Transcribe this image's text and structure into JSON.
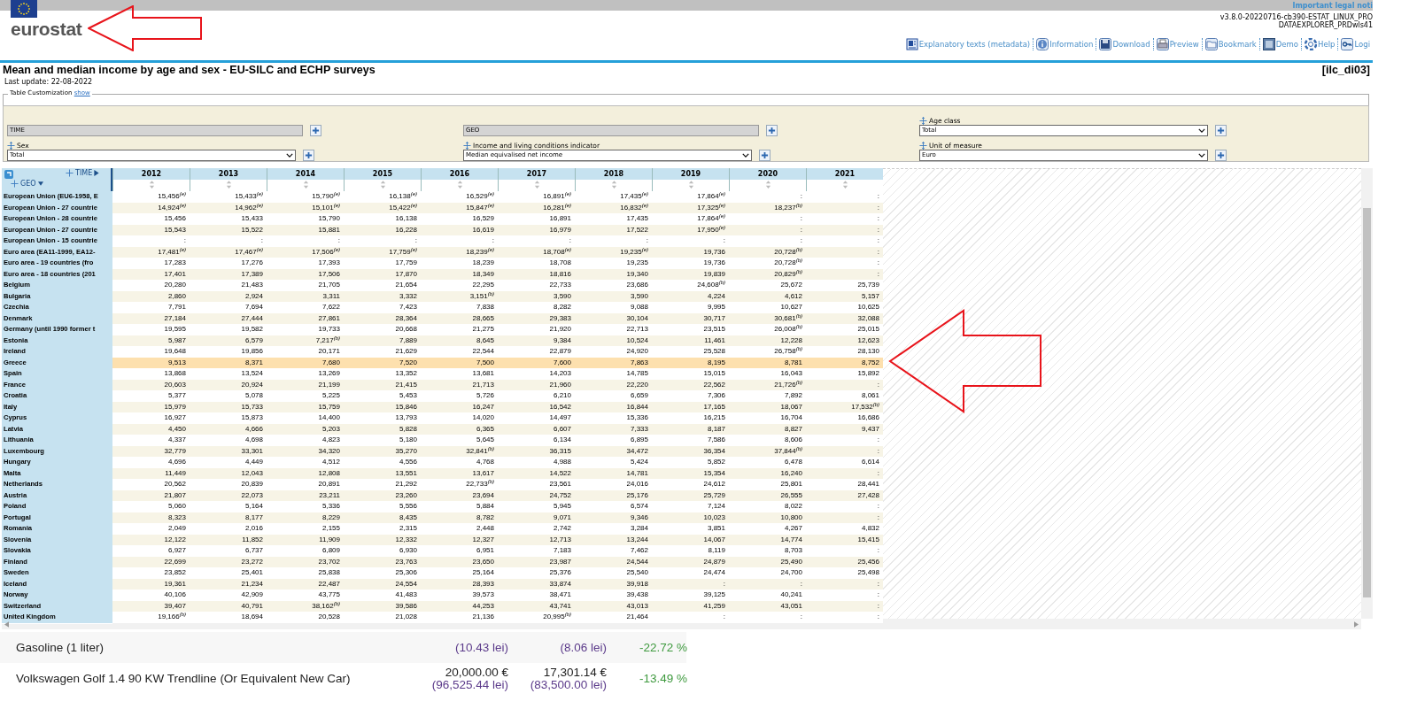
{
  "top_bar": {
    "legal_link": "Important legal noti"
  },
  "logo": {
    "text": "eurostat"
  },
  "version": [
    "v3.8.0-20220716-cb390-ESTAT_LINUX_PRO",
    "DATAEXPLORER_PRDwls41"
  ],
  "toolbar": [
    {
      "kind": "metadata",
      "label": "Explanatory texts (metadata)"
    },
    {
      "kind": "info",
      "label": "Information"
    },
    {
      "kind": "download",
      "label": "Download"
    },
    {
      "kind": "preview",
      "label": "Preview"
    },
    {
      "kind": "bookmark",
      "label": "Bookmark"
    },
    {
      "kind": "demo",
      "label": "Demo"
    },
    {
      "kind": "help",
      "label": "Help"
    },
    {
      "kind": "login",
      "label": "Logi"
    }
  ],
  "title": "Mean and median income by age and sex - EU-SILC and ECHP surveys",
  "dataset_code": "[ilc_di03]",
  "last_update": "Last update: 22-08-2022",
  "customization": {
    "legend": "Table Customization",
    "link": "show"
  },
  "filters": [
    {
      "kind": "fixed",
      "value": "TIME"
    },
    {
      "kind": "fixed",
      "value": "GEO"
    },
    {
      "kind": "select",
      "label": "Age class",
      "value": "Total"
    },
    {
      "kind": "select",
      "label": "Sex",
      "value": "Total"
    },
    {
      "kind": "select",
      "label": "Income and living conditions indicator",
      "value": "Median equivalised net income"
    },
    {
      "kind": "select",
      "label": "Unit of measure",
      "value": "Euro"
    }
  ],
  "table": {
    "column_dimension": "TIME",
    "row_dimension": "GEO",
    "columns": [
      "2012",
      "2013",
      "2014",
      "2015",
      "2016",
      "2017",
      "2018",
      "2019",
      "2020",
      "2021"
    ],
    "rows": [
      {
        "label": "European Union (EU6-1958, E",
        "selected": false,
        "cells": [
          "15,456$^{(e)}$",
          "15,433$^{(e)}$",
          "15,790$^{(e)}$",
          "16,138$^{(e)}$",
          "16,529$^{(e)}$",
          "16,891$^{(e)}$",
          "17,435$^{(e)}$",
          "17,864$^{(e)}$",
          ":",
          ":"
        ]
      },
      {
        "label": "European Union - 27 countrie",
        "selected": false,
        "cells": [
          "14,924$^{(e)}$",
          "14,962$^{(e)}$",
          "15,101$^{(e)}$",
          "15,422$^{(e)}$",
          "15,847$^{(e)}$",
          "16,281$^{(e)}$",
          "16,832$^{(e)}$",
          "17,325$^{(e)}$",
          "18,237$^{(b)}$",
          ":"
        ]
      },
      {
        "label": "European Union - 28 countrie",
        "selected": false,
        "cells": [
          "15,456",
          "15,433",
          "15,790",
          "16,138",
          "16,529",
          "16,891",
          "17,435",
          "17,864$^{(e)}$",
          ":",
          ":"
        ]
      },
      {
        "label": "European Union - 27 countrie",
        "selected": false,
        "cells": [
          "15,543",
          "15,522",
          "15,881",
          "16,228",
          "16,619",
          "16,979",
          "17,522",
          "17,950$^{(e)}$",
          ":",
          ":"
        ]
      },
      {
        "label": "European Union - 15 countrie",
        "selected": false,
        "cells": [
          ":",
          ":",
          ":",
          ":",
          ":",
          ":",
          ":",
          ":",
          ":",
          ":"
        ]
      },
      {
        "label": "Euro area (EA11-1999, EA12-",
        "selected": false,
        "cells": [
          "17,481$^{(e)}$",
          "17,467$^{(e)}$",
          "17,506$^{(e)}$",
          "17,759$^{(e)}$",
          "18,239$^{(e)}$",
          "18,708$^{(e)}$",
          "19,235$^{(e)}$",
          "19,736",
          "20,728$^{(b)}$",
          ":"
        ]
      },
      {
        "label": "Euro area - 19 countries (fro",
        "selected": false,
        "cells": [
          "17,283",
          "17,276",
          "17,393",
          "17,759",
          "18,239",
          "18,708",
          "19,235",
          "19,736",
          "20,728$^{(b)}$",
          ":"
        ]
      },
      {
        "label": "Euro area - 18 countries (201",
        "selected": false,
        "cells": [
          "17,401",
          "17,389",
          "17,506",
          "17,870",
          "18,349",
          "18,816",
          "19,340",
          "19,839",
          "20,829$^{(b)}$",
          ":"
        ]
      },
      {
        "label": "Belgium",
        "selected": false,
        "cells": [
          "20,280",
          "21,483",
          "21,705",
          "21,654",
          "22,295",
          "22,733",
          "23,686",
          "24,608$^{(b)}$",
          "25,672",
          "25,739"
        ]
      },
      {
        "label": "Bulgaria",
        "selected": false,
        "cells": [
          "2,860",
          "2,924",
          "3,311",
          "3,332",
          "3,151$^{(b)}$",
          "3,590",
          "3,590",
          "4,224",
          "4,612",
          "5,157"
        ]
      },
      {
        "label": "Czechia",
        "selected": false,
        "cells": [
          "7,791",
          "7,694",
          "7,622",
          "7,423",
          "7,838",
          "8,282",
          "9,088",
          "9,995",
          "10,627",
          "10,625"
        ]
      },
      {
        "label": "Denmark",
        "selected": false,
        "cells": [
          "27,184",
          "27,444",
          "27,861",
          "28,364",
          "28,665",
          "29,383",
          "30,104",
          "30,717",
          "30,681$^{(b)}$",
          "32,088"
        ]
      },
      {
        "label": "Germany (until 1990 former t",
        "selected": false,
        "cells": [
          "19,595",
          "19,582",
          "19,733",
          "20,668",
          "21,275",
          "21,920",
          "22,713",
          "23,515",
          "26,008$^{(b)}$",
          "25,015"
        ]
      },
      {
        "label": "Estonia",
        "selected": false,
        "cells": [
          "5,987",
          "6,579",
          "7,217$^{(b)}$",
          "7,889",
          "8,645",
          "9,384",
          "10,524",
          "11,461",
          "12,228",
          "12,623"
        ]
      },
      {
        "label": "Ireland",
        "selected": false,
        "cells": [
          "19,648",
          "19,856",
          "20,171",
          "21,629",
          "22,544",
          "22,879",
          "24,920",
          "25,528",
          "26,758$^{(b)}$",
          "28,130"
        ]
      },
      {
        "label": "Greece",
        "selected": true,
        "cells": [
          "9,513",
          "8,371",
          "7,680",
          "7,520",
          "7,500",
          "7,600",
          "7,863",
          "8,195",
          "8,781",
          "8,752"
        ]
      },
      {
        "label": "Spain",
        "selected": false,
        "cells": [
          "13,868",
          "13,524",
          "13,269",
          "13,352",
          "13,681",
          "14,203",
          "14,785",
          "15,015",
          "16,043",
          "15,892"
        ]
      },
      {
        "label": "France",
        "selected": false,
        "cells": [
          "20,603",
          "20,924",
          "21,199",
          "21,415",
          "21,713",
          "21,960",
          "22,220",
          "22,562",
          "21,726$^{(b)}$",
          ":"
        ]
      },
      {
        "label": "Croatia",
        "selected": false,
        "cells": [
          "5,377",
          "5,078",
          "5,225",
          "5,453",
          "5,726",
          "6,210",
          "6,659",
          "7,306",
          "7,892",
          "8,061"
        ]
      },
      {
        "label": "Italy",
        "selected": false,
        "cells": [
          "15,979",
          "15,733",
          "15,759",
          "15,846",
          "16,247",
          "16,542",
          "16,844",
          "17,165",
          "18,067",
          "17,532$^{(b)}$"
        ]
      },
      {
        "label": "Cyprus",
        "selected": false,
        "cells": [
          "16,927",
          "15,873",
          "14,400",
          "13,793",
          "14,020",
          "14,497",
          "15,336",
          "16,215",
          "16,704",
          "16,686"
        ]
      },
      {
        "label": "Latvia",
        "selected": false,
        "cells": [
          "4,450",
          "4,666",
          "5,203",
          "5,828",
          "6,365",
          "6,607",
          "7,333",
          "8,187",
          "8,827",
          "9,437"
        ]
      },
      {
        "label": "Lithuania",
        "selected": false,
        "cells": [
          "4,337",
          "4,698",
          "4,823",
          "5,180",
          "5,645",
          "6,134",
          "6,895",
          "7,586",
          "8,606",
          ":"
        ]
      },
      {
        "label": "Luxembourg",
        "selected": false,
        "cells": [
          "32,779",
          "33,301",
          "34,320",
          "35,270",
          "32,841$^{(b)}$",
          "36,315",
          "34,472",
          "36,354",
          "37,844$^{(b)}$",
          ":"
        ]
      },
      {
        "label": "Hungary",
        "selected": false,
        "cells": [
          "4,696",
          "4,449",
          "4,512",
          "4,556",
          "4,768",
          "4,988",
          "5,424",
          "5,852",
          "6,478",
          "6,614"
        ]
      },
      {
        "label": "Malta",
        "selected": false,
        "cells": [
          "11,449",
          "12,043",
          "12,808",
          "13,551",
          "13,617",
          "14,522",
          "14,781",
          "15,354",
          "16,240",
          ":"
        ]
      },
      {
        "label": "Netherlands",
        "selected": false,
        "cells": [
          "20,562",
          "20,839",
          "20,891",
          "21,292",
          "22,733$^{(b)}$",
          "23,561",
          "24,016",
          "24,612",
          "25,801",
          "28,441"
        ]
      },
      {
        "label": "Austria",
        "selected": false,
        "cells": [
          "21,807",
          "22,073",
          "23,211",
          "23,260",
          "23,694",
          "24,752",
          "25,176",
          "25,729",
          "26,555",
          "27,428"
        ]
      },
      {
        "label": "Poland",
        "selected": false,
        "cells": [
          "5,060",
          "5,164",
          "5,336",
          "5,556",
          "5,884",
          "5,945",
          "6,574",
          "7,124",
          "8,022",
          ":"
        ]
      },
      {
        "label": "Portugal",
        "selected": false,
        "cells": [
          "8,323",
          "8,177",
          "8,229",
          "8,435",
          "8,782",
          "9,071",
          "9,346",
          "10,023",
          "10,800",
          ":"
        ]
      },
      {
        "label": "Romania",
        "selected": false,
        "cells": [
          "2,049",
          "2,016",
          "2,155",
          "2,315",
          "2,448",
          "2,742",
          "3,284",
          "3,851",
          "4,267",
          "4,832"
        ]
      },
      {
        "label": "Slovenia",
        "selected": false,
        "cells": [
          "12,122",
          "11,852",
          "11,909",
          "12,332",
          "12,327",
          "12,713",
          "13,244",
          "14,067",
          "14,774",
          "15,415"
        ]
      },
      {
        "label": "Slovakia",
        "selected": false,
        "cells": [
          "6,927",
          "6,737",
          "6,809",
          "6,930",
          "6,951",
          "7,183",
          "7,462",
          "8,119",
          "8,703",
          ":"
        ]
      },
      {
        "label": "Finland",
        "selected": false,
        "cells": [
          "22,699",
          "23,272",
          "23,702",
          "23,763",
          "23,650",
          "23,987",
          "24,544",
          "24,879",
          "25,490",
          "25,456"
        ]
      },
      {
        "label": "Sweden",
        "selected": false,
        "cells": [
          "23,852",
          "25,401",
          "25,838",
          "25,306",
          "25,164",
          "25,376",
          "25,540",
          "24,474",
          "24,700",
          "25,498"
        ]
      },
      {
        "label": "Iceland",
        "selected": false,
        "cells": [
          "19,361",
          "21,234",
          "22,487",
          "24,554",
          "28,393",
          "33,874",
          "39,918",
          ":",
          ":",
          ":"
        ]
      },
      {
        "label": "Norway",
        "selected": false,
        "cells": [
          "40,106",
          "42,909",
          "43,775",
          "41,483",
          "39,573",
          "38,471",
          "39,438",
          "39,125",
          "40,241",
          ":"
        ]
      },
      {
        "label": "Switzerland",
        "selected": false,
        "cells": [
          "39,407",
          "40,791",
          "38,162$^{(b)}$",
          "39,586",
          "44,253",
          "43,741",
          "43,013",
          "41,259",
          "43,051",
          ":"
        ]
      },
      {
        "label": "United Kingdom",
        "selected": false,
        "cells": [
          "19,166$^{(b)}$",
          "18,694",
          "20,528",
          "21,028",
          "21,136",
          "20,995$^{(b)}$",
          "21,464",
          ":",
          ":",
          ":"
        ]
      }
    ]
  },
  "price_rows": [
    {
      "item": "Gasoline (1 liter)",
      "lei_1": "(10.43 lei)",
      "lei_2": "(8.06 lei)",
      "change": "-22.72 %"
    },
    {
      "item": "Volkswagen Golf 1.4 90 KW Trendline (Or Equivalent New Car)",
      "price_1": "20,000.00 €",
      "lei_1": "(96,525.44 lei)",
      "price_2": "17,301.14 €",
      "lei_2": "(83,500.00 lei)",
      "change": "-13.49 %"
    }
  ]
}
